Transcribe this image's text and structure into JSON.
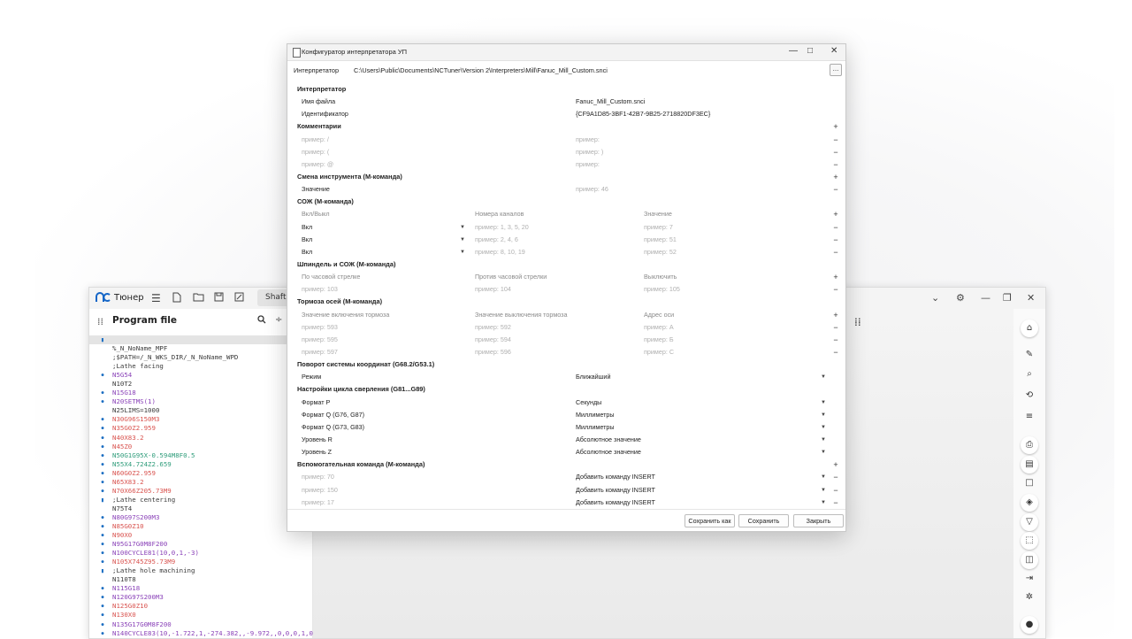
{
  "tuner": {
    "app_name": "Тюнер",
    "mode_button": "Shaft",
    "panel_title": "Program file",
    "icons": [
      "logo-icon",
      "menu-icon",
      "new-file-icon",
      "open-folder-icon",
      "save-icon",
      "edit-icon",
      "search-icon",
      "split-icon",
      "grid-icon",
      "settings-icon"
    ],
    "code_lines": [
      {
        "text": "",
        "color": "black",
        "marker": "bookmark",
        "highlight": true
      },
      {
        "text": "%_N_NoName_MPF",
        "color": "black",
        "marker": ""
      },
      {
        "text": ";$PATH=/_N_WKS_DIR/_N_NoName_WPD",
        "color": "black",
        "marker": ""
      },
      {
        "text": ";Lathe facing",
        "color": "black",
        "marker": ""
      },
      {
        "text": "N5G54",
        "color": "purple",
        "marker": "dot"
      },
      {
        "text": "N10T2",
        "color": "black",
        "marker": ""
      },
      {
        "text": "N15G18",
        "color": "purple",
        "marker": "dot"
      },
      {
        "text": "N20SETMS(1)",
        "color": "purple",
        "marker": "dot"
      },
      {
        "text": "N25LIMS=1000",
        "color": "black",
        "marker": ""
      },
      {
        "text": "N30G96S150M3",
        "color": "red",
        "marker": "dot"
      },
      {
        "text": "N35G0Z2.959",
        "color": "red",
        "marker": "dot"
      },
      {
        "text": "N40X83.2",
        "color": "red",
        "marker": "dot"
      },
      {
        "text": "N45Z0",
        "color": "red",
        "marker": "dot"
      },
      {
        "text": "N50G1G95X-0.594M8F0.5",
        "color": "green",
        "marker": "dot"
      },
      {
        "text": "N55X4.724Z2.659",
        "color": "green",
        "marker": "dot"
      },
      {
        "text": "N60G0Z2.959",
        "color": "red",
        "marker": "dot"
      },
      {
        "text": "N65X83.2",
        "color": "red",
        "marker": "dot"
      },
      {
        "text": "N70X66Z205.73M9",
        "color": "red",
        "marker": "dot"
      },
      {
        "text": ";Lathe centering",
        "color": "black",
        "marker": "bookmark"
      },
      {
        "text": "N75T4",
        "color": "black",
        "marker": ""
      },
      {
        "text": "N80G97S200M3",
        "color": "purple",
        "marker": "dot"
      },
      {
        "text": "N85G0Z10",
        "color": "red",
        "marker": "dot"
      },
      {
        "text": "N90X0",
        "color": "red",
        "marker": "dot"
      },
      {
        "text": "N95G17G0M8F200",
        "color": "purple",
        "marker": "dot"
      },
      {
        "text": "N100CYCLE81(10,0,1,-3)",
        "color": "purple",
        "marker": "dot"
      },
      {
        "text": "N105X745Z95.73M9",
        "color": "red",
        "marker": "dot"
      },
      {
        "text": ";Lathe hole machining",
        "color": "black",
        "marker": "bookmark"
      },
      {
        "text": "N110T8",
        "color": "black",
        "marker": ""
      },
      {
        "text": "N115G18",
        "color": "purple",
        "marker": "dot"
      },
      {
        "text": "N120G97S200M3",
        "color": "purple",
        "marker": "dot"
      },
      {
        "text": "N125G0Z10",
        "color": "red",
        "marker": "dot"
      },
      {
        "text": "N130X0",
        "color": "red",
        "marker": "dot"
      },
      {
        "text": "N135G17G0M8F200",
        "color": "purple",
        "marker": "dot"
      },
      {
        "text": "N140CYCLE83(10,-1.722,1,-274.382,,-9.972,,0,0,0,1,0",
        "color": "purple",
        "marker": "dot"
      }
    ]
  },
  "dialog": {
    "title": "Конфигуратор интерпретатора УП",
    "path_label": "Интерпретатор",
    "path_value": "C:\\Users\\Public\\Documents\\NCTuner\\Version 2\\Interpreters\\Mill\\Fanuc_Mill_Custom.snci",
    "path_button": "...",
    "rows": [
      {
        "kind": "section",
        "label": "Интерпретатор"
      },
      {
        "kind": "field",
        "label": "Имя файла",
        "value": "Fanuc_Mill_Custom.snci"
      },
      {
        "kind": "field",
        "label": "Идентификатор",
        "value": "{CF9A1D85-3BF1-42B7-9B25-2718820DF3EC}"
      },
      {
        "kind": "section",
        "label": "Комментарии",
        "action": "+"
      },
      {
        "kind": "pair",
        "c1": "пример: /",
        "c2": "пример:",
        "action": "−"
      },
      {
        "kind": "pair",
        "c1": "пример: (",
        "c2": "пример: )",
        "action": "−"
      },
      {
        "kind": "pair",
        "c1": "пример: @",
        "c2": "пример:",
        "action": "−"
      },
      {
        "kind": "section",
        "label": "Смена инструмента (М-команда)",
        "action": "+"
      },
      {
        "kind": "pairlabel",
        "c1": "Значение",
        "c2": "пример: 46",
        "action": "−"
      },
      {
        "kind": "section",
        "label": "СОЖ (М-команда)"
      },
      {
        "kind": "header3",
        "c1": "Вкл/Выкл",
        "c2": "Номера каналов",
        "c3": "Значение",
        "action": "+"
      },
      {
        "kind": "combo3",
        "c1": "Вкл",
        "c2": "пример: 1, 3, 5, 20",
        "c3": "пример: 7",
        "action": "−"
      },
      {
        "kind": "combo3",
        "c1": "Вкл",
        "c2": "пример: 2, 4, 6",
        "c3": "пример: 51",
        "action": "−"
      },
      {
        "kind": "combo3",
        "c1": "Вкл",
        "c2": "пример: 8, 10, 19",
        "c3": "пример: 52",
        "action": "−"
      },
      {
        "kind": "section",
        "label": "Шпиндель и СОЖ (М-команда)"
      },
      {
        "kind": "header3",
        "c1": "По часовой стрелке",
        "c2": "Против часовой стрелки",
        "c3": "Выключить",
        "action": "+"
      },
      {
        "kind": "ph3",
        "c1": "пример: 103",
        "c2": "пример: 104",
        "c3": "пример: 105",
        "action": "−"
      },
      {
        "kind": "section",
        "label": "Тормоза осей (М-команда)"
      },
      {
        "kind": "header3",
        "c1": "Значение включения тормоза",
        "c2": "Значение выключения тормоза",
        "c3": "Адрес оси",
        "action": "+"
      },
      {
        "kind": "ph3",
        "c1": "пример: 593",
        "c2": "пример: 592",
        "c3": "пример: A",
        "action": "−"
      },
      {
        "kind": "ph3",
        "c1": "пример: 595",
        "c2": "пример: 594",
        "c3": "пример: Б",
        "action": "−"
      },
      {
        "kind": "ph3",
        "c1": "пример: 597",
        "c2": "пример: 596",
        "c3": "пример: C",
        "action": "−"
      },
      {
        "kind": "section",
        "label": "Поворот системы координат (G68.2/G53.1)"
      },
      {
        "kind": "select",
        "label": "Режим",
        "value": "Ближайший"
      },
      {
        "kind": "section",
        "label": "Настройки цикла сверления (G81...G89)"
      },
      {
        "kind": "select",
        "label": "Формат P",
        "value": "Секунды"
      },
      {
        "kind": "select",
        "label": "Формат Q (G76, G87)",
        "value": "Миллиметры"
      },
      {
        "kind": "select",
        "label": "Формат Q (G73, G83)",
        "value": "Миллиметры"
      },
      {
        "kind": "select",
        "label": "Уровень R",
        "value": "Абсолютное значение"
      },
      {
        "kind": "select",
        "label": "Уровень Z",
        "value": "Абсолютное значение"
      },
      {
        "kind": "section",
        "label": "Вспомогательная команда (М-команда)",
        "action": "+"
      },
      {
        "kind": "phselect",
        "label": "пример: 70",
        "value": "Добавить команду INSERT",
        "action": "−"
      },
      {
        "kind": "phselect",
        "label": "пример: 150",
        "value": "Добавить команду INSERT",
        "action": "−"
      },
      {
        "kind": "phselect",
        "label": "пример: 17",
        "value": "Добавить команду INSERT",
        "action": "−"
      }
    ],
    "buttons": {
      "save_as": "Сохранить как",
      "save": "Сохранить",
      "close": "Закрыть"
    }
  }
}
